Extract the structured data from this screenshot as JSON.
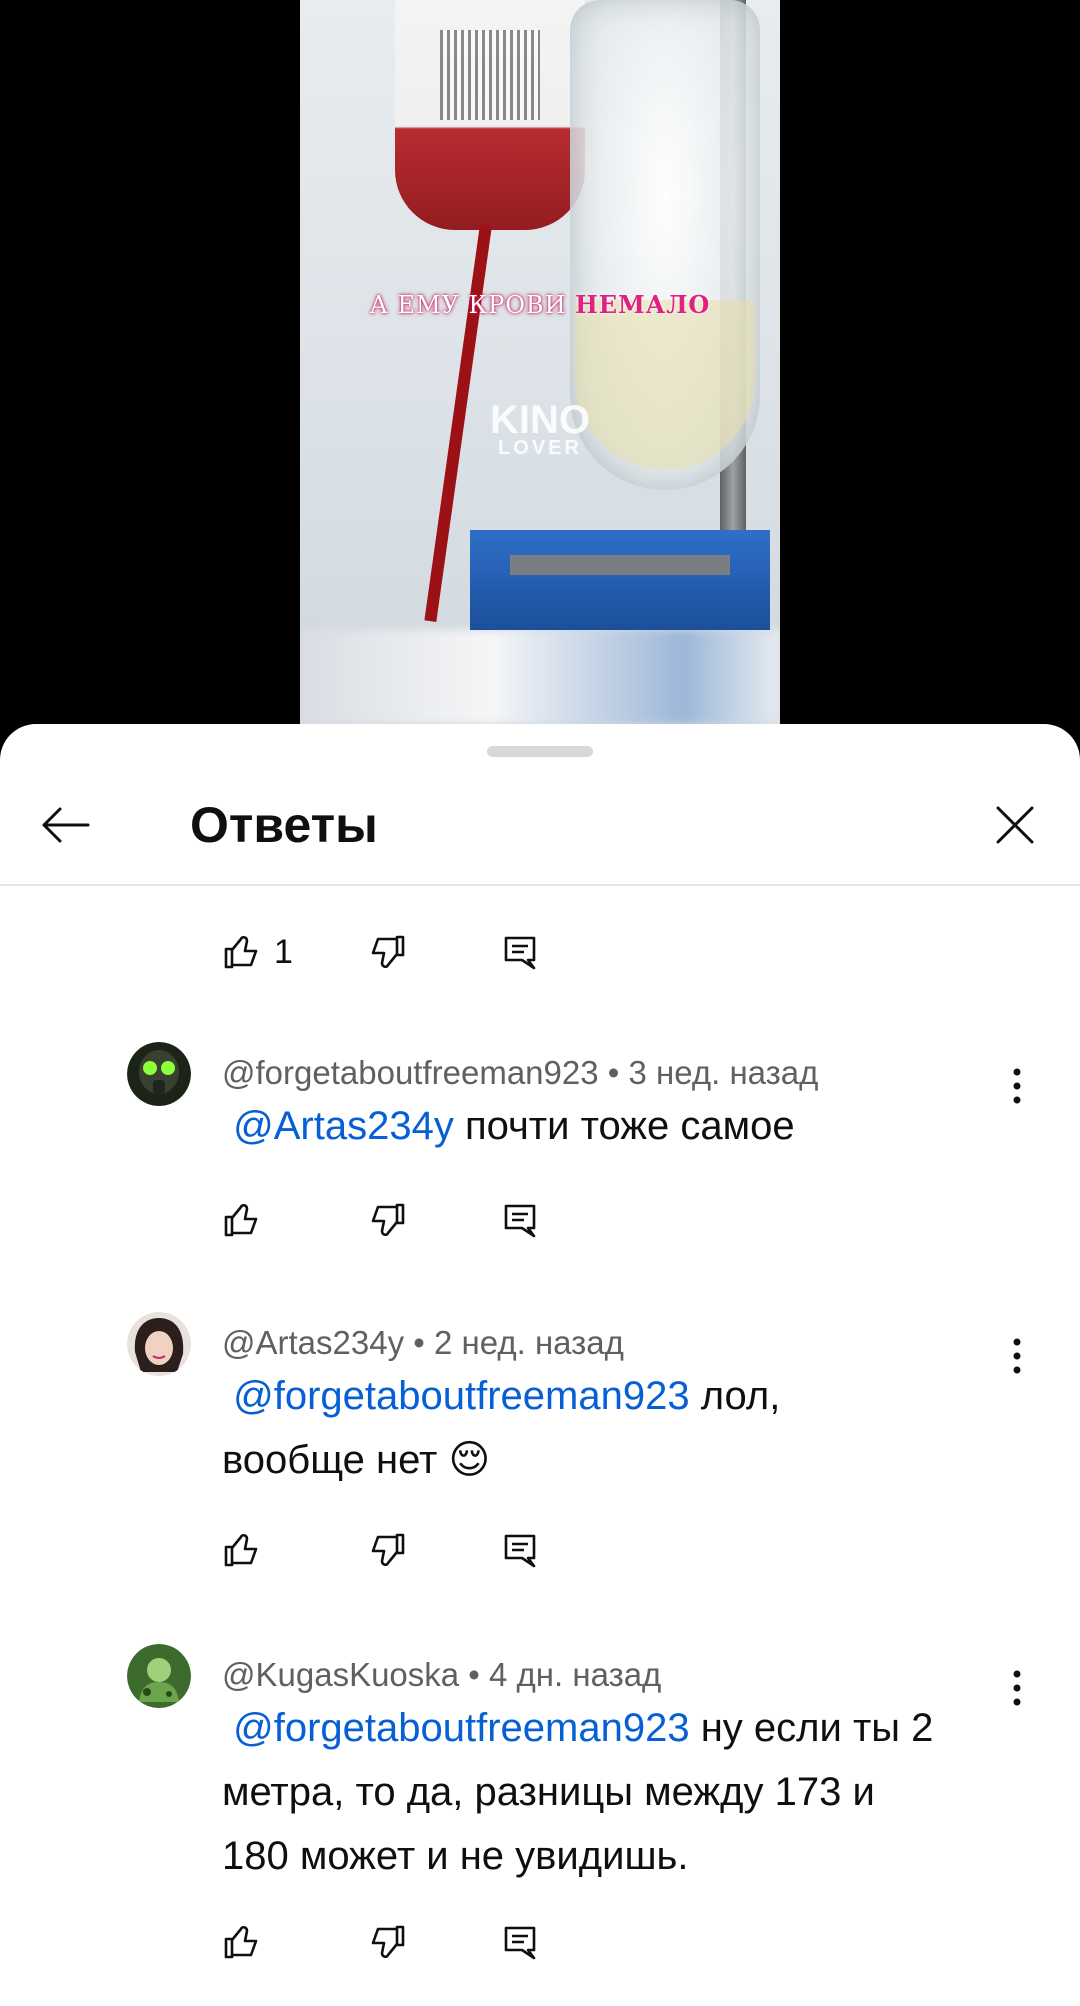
{
  "video": {
    "overlay_text_plain": "А ЕМУ КРОВИ ",
    "overlay_text_highlight": "НЕМАЛО",
    "watermark_main": "KINO",
    "watermark_sub": "LOVER"
  },
  "header": {
    "title": "Ответы"
  },
  "top_actions": {
    "like_count": "1"
  },
  "comments": [
    {
      "author": "@forgetaboutfreeman923",
      "time": " • 3 нед. назад",
      "mention": "@Artas234y",
      "text": " почти тоже самое"
    },
    {
      "author": "@Artas234y",
      "time": " • 2 нед. назад",
      "mention": "@forgetaboutfreeman923",
      "text_line1": "  лол,",
      "text_line2": "вообще нет 😌"
    },
    {
      "author": "@KugasKuoska",
      "time": " • 4 дн. назад",
      "mention": "@forgetaboutfreeman923",
      "text_line1": " ну если ты 2",
      "text_line2": "метра, то да, разницы между 173 и",
      "text_line3": "180 может и не увидишь."
    }
  ]
}
